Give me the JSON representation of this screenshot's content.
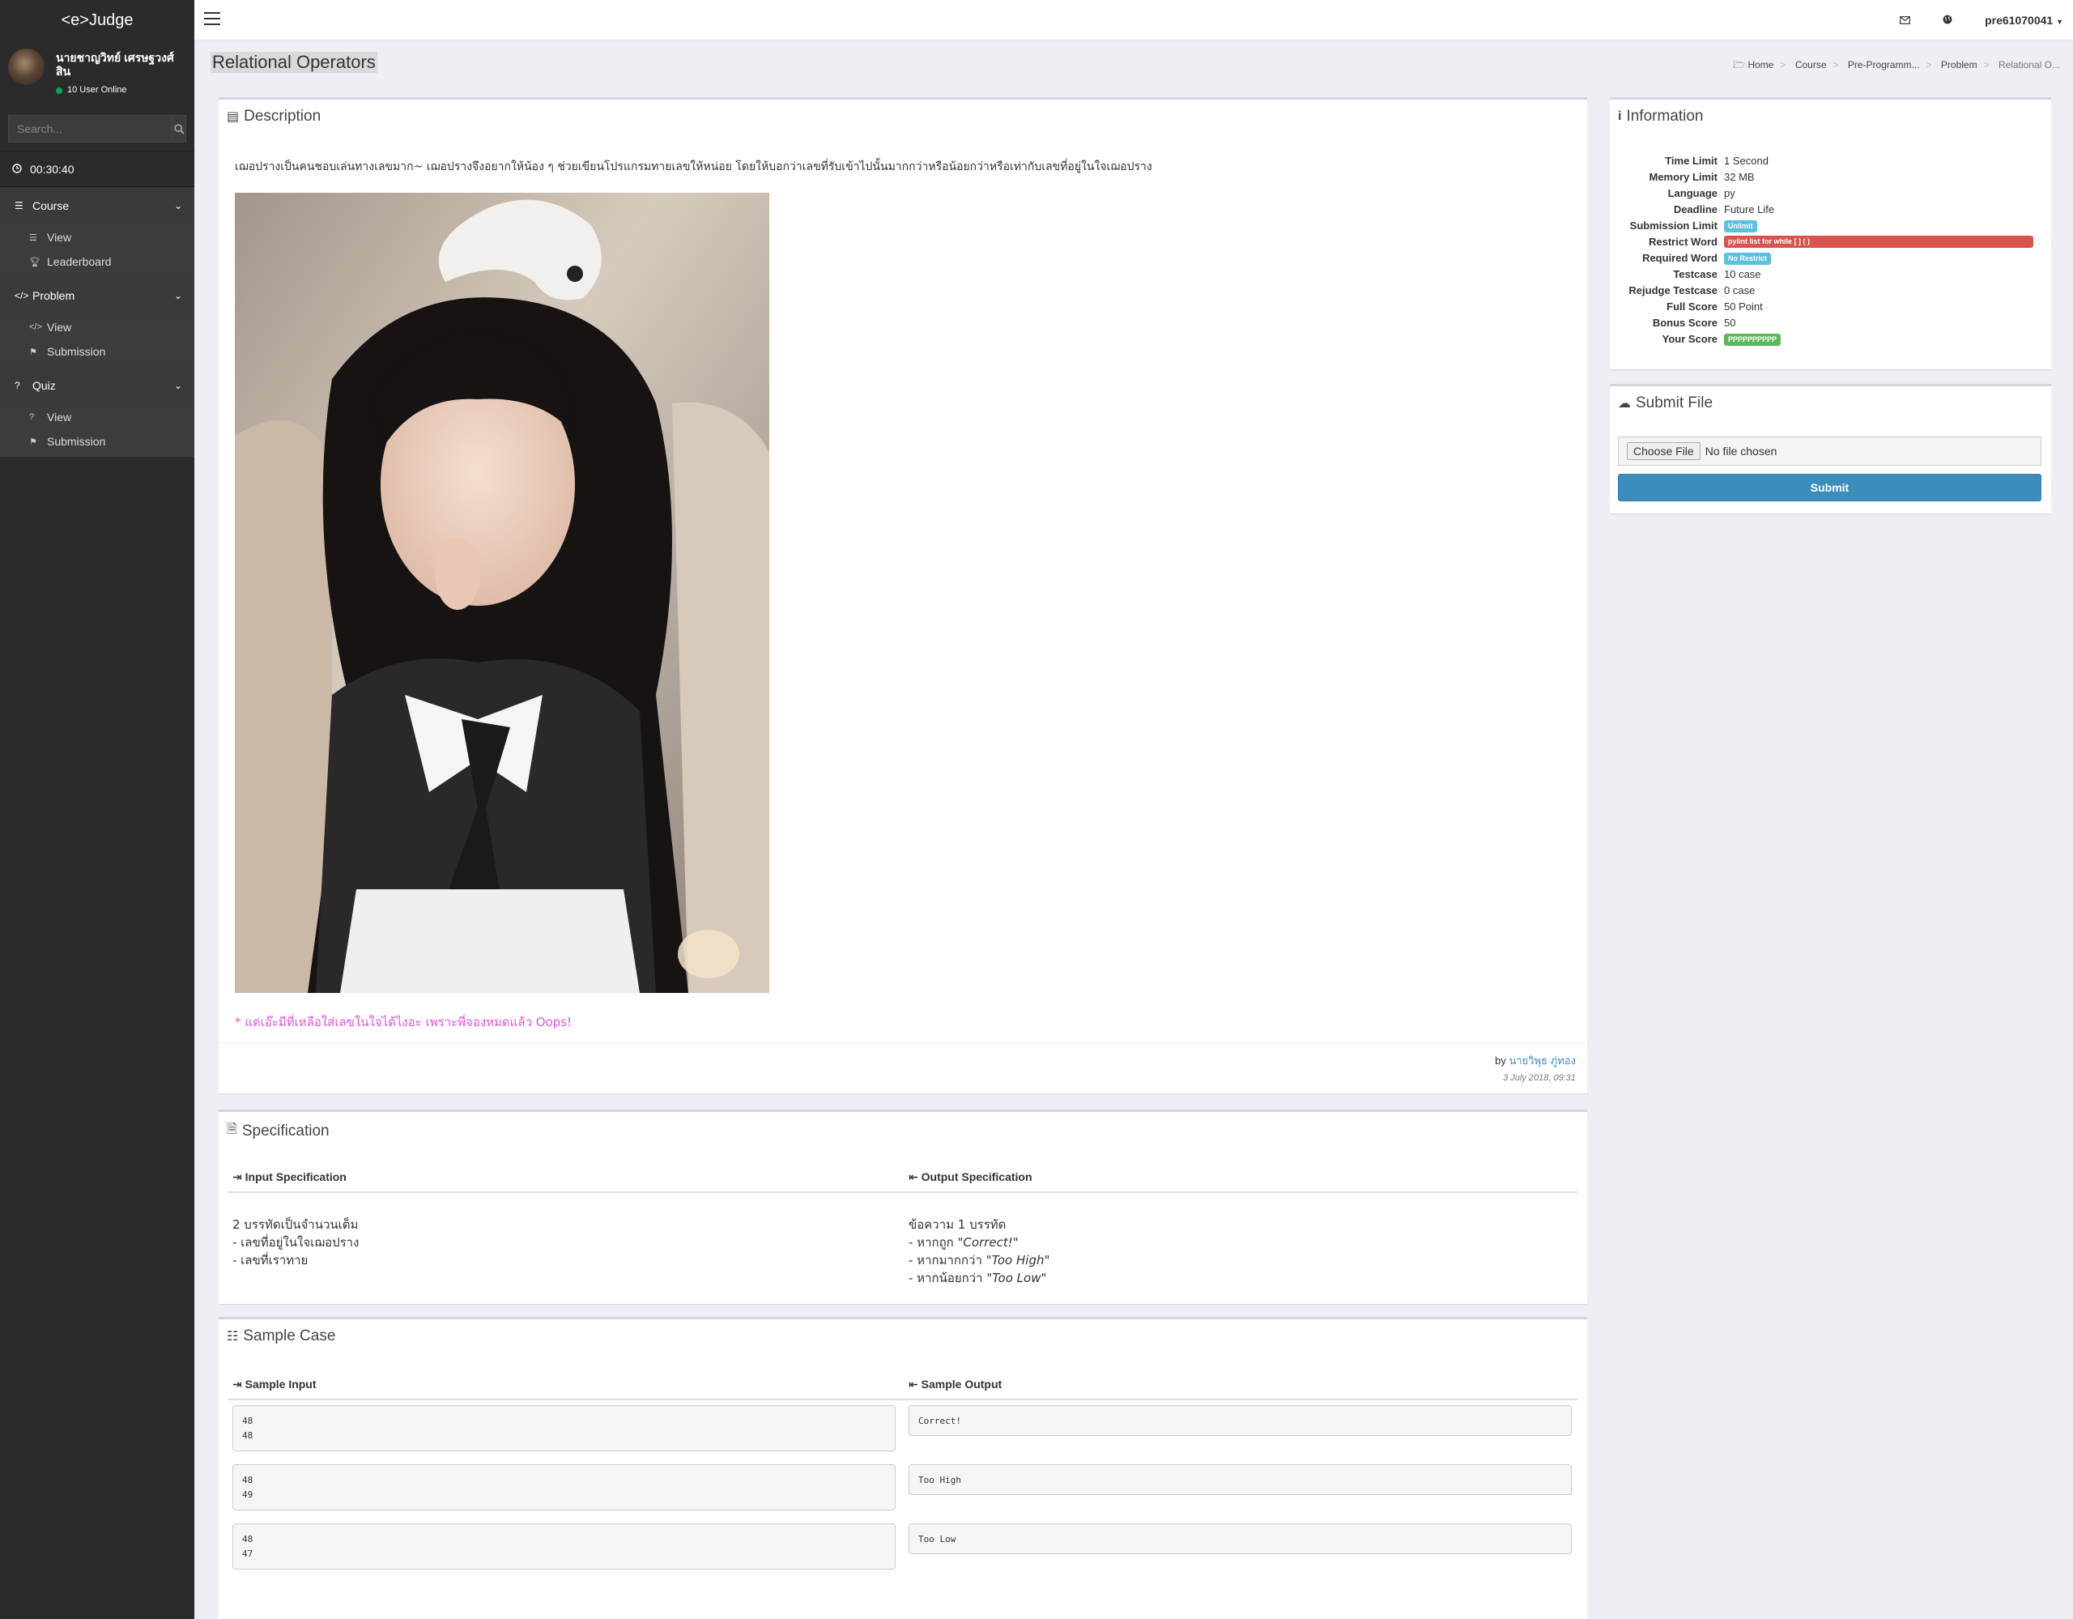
{
  "sidebar": {
    "logo": "<e>Judge",
    "user_name": "นายชาญวิทย์ เศรษฐวงศ์สิน",
    "online_text": "10 User Online",
    "search_placeholder": "Search...",
    "timer": "00:30:40",
    "menus": [
      {
        "label": "Course",
        "icon": "list-icon",
        "items": [
          {
            "label": "View",
            "icon": "list-icon"
          },
          {
            "label": "Leaderboard",
            "icon": "trophy-icon"
          }
        ]
      },
      {
        "label": "Problem",
        "icon": "code-icon",
        "items": [
          {
            "label": "View",
            "icon": "code-icon"
          },
          {
            "label": "Submission",
            "icon": "flag-icon"
          }
        ]
      },
      {
        "label": "Quiz",
        "icon": "question-icon",
        "items": [
          {
            "label": "View",
            "icon": "question-icon"
          },
          {
            "label": "Submission",
            "icon": "flag-icon"
          }
        ]
      }
    ]
  },
  "topbar": {
    "username": "pre61070041"
  },
  "page": {
    "title": "Relational Operators",
    "breadcrumb": [
      "Home",
      "Course",
      "Pre-Programm...",
      "Problem",
      "Relational O..."
    ]
  },
  "description": {
    "title": "Description",
    "text": "เฌอปรางเป็นคนชอบเล่นทางเลขมาก~ เฌอปรางจึงอยากให้น้อง ๆ ช่วยเขียนโปรแกรมทายเลขให้หน่อย โดยให้บอกว่าเลขที่รับเข้าไปนั้นมากกว่าหรือน้อยกว่าหรือเท่ากับเลขที่อยู่ในใจเฌอปราง",
    "note": "* แต่เอ๊ะมีที่เหลือใส่เลขในใจได้ไงอะ เพราะพี่จองหมดแล้ว Oops!",
    "by_label": "by",
    "author": "นายวิพุธ ภู่ทอง",
    "date": "3 July 2018, 09:31"
  },
  "specification": {
    "title": "Specification",
    "input_head": "Input Specification",
    "output_head": "Output Specification",
    "input_lines": [
      "2 บรรทัดเป็นจำนวนเต็ม",
      "- เลขที่อยู่ในใจเฌอปราง",
      "- เลขที่เราทาย"
    ],
    "output_line1": "ข้อความ 1 บรรทัด",
    "output_rows": [
      {
        "prefix": "- หากถูก ",
        "value": "\"Correct!\""
      },
      {
        "prefix": "- หากมากกว่า ",
        "value": "\"Too High\""
      },
      {
        "prefix": "- หากน้อยกว่า ",
        "value": "\"Too Low\""
      }
    ]
  },
  "sample": {
    "title": "Sample Case",
    "input_head": "Sample Input",
    "output_head": "Sample Output",
    "cases": [
      {
        "input": "48\n48",
        "output": "Correct!"
      },
      {
        "input": "48\n49",
        "output": "Too High"
      },
      {
        "input": "48\n47",
        "output": "Too Low"
      }
    ]
  },
  "information": {
    "title": "Information",
    "rows": [
      {
        "key": "Time Limit",
        "value": "1 Second"
      },
      {
        "key": "Memory Limit",
        "value": "32 MB"
      },
      {
        "key": "Language",
        "value": "py"
      },
      {
        "key": "Deadline",
        "value": "Future Life"
      },
      {
        "key": "Submission Limit",
        "badge": "Unlimit",
        "badge_color": "blue"
      },
      {
        "key": "Restrict Word",
        "badge": "pylint list for while [ ] ( )",
        "badge_color": "red"
      },
      {
        "key": "Required Word",
        "badge": "No Restrict",
        "badge_color": "blue"
      },
      {
        "key": "Testcase",
        "value": "10 case"
      },
      {
        "key": "Rejudge Testcase",
        "value": "0 case"
      },
      {
        "key": "Full Score",
        "value": "50 Point"
      },
      {
        "key": "Bonus Score",
        "value": "50"
      },
      {
        "key": "Your Score",
        "badge": "PPPPPPPPPP",
        "badge_color": "green"
      }
    ]
  },
  "submit": {
    "title": "Submit File",
    "choose_label": "Choose File",
    "no_file": "No file chosen",
    "button": "Submit"
  },
  "colors": {
    "sidebar_bg": "#2b2b2b",
    "accent": "#3c8dbc",
    "note": "#e055d8",
    "label_blue": "#5bc0de",
    "label_red": "#d9534f",
    "label_green": "#5cb85c"
  }
}
